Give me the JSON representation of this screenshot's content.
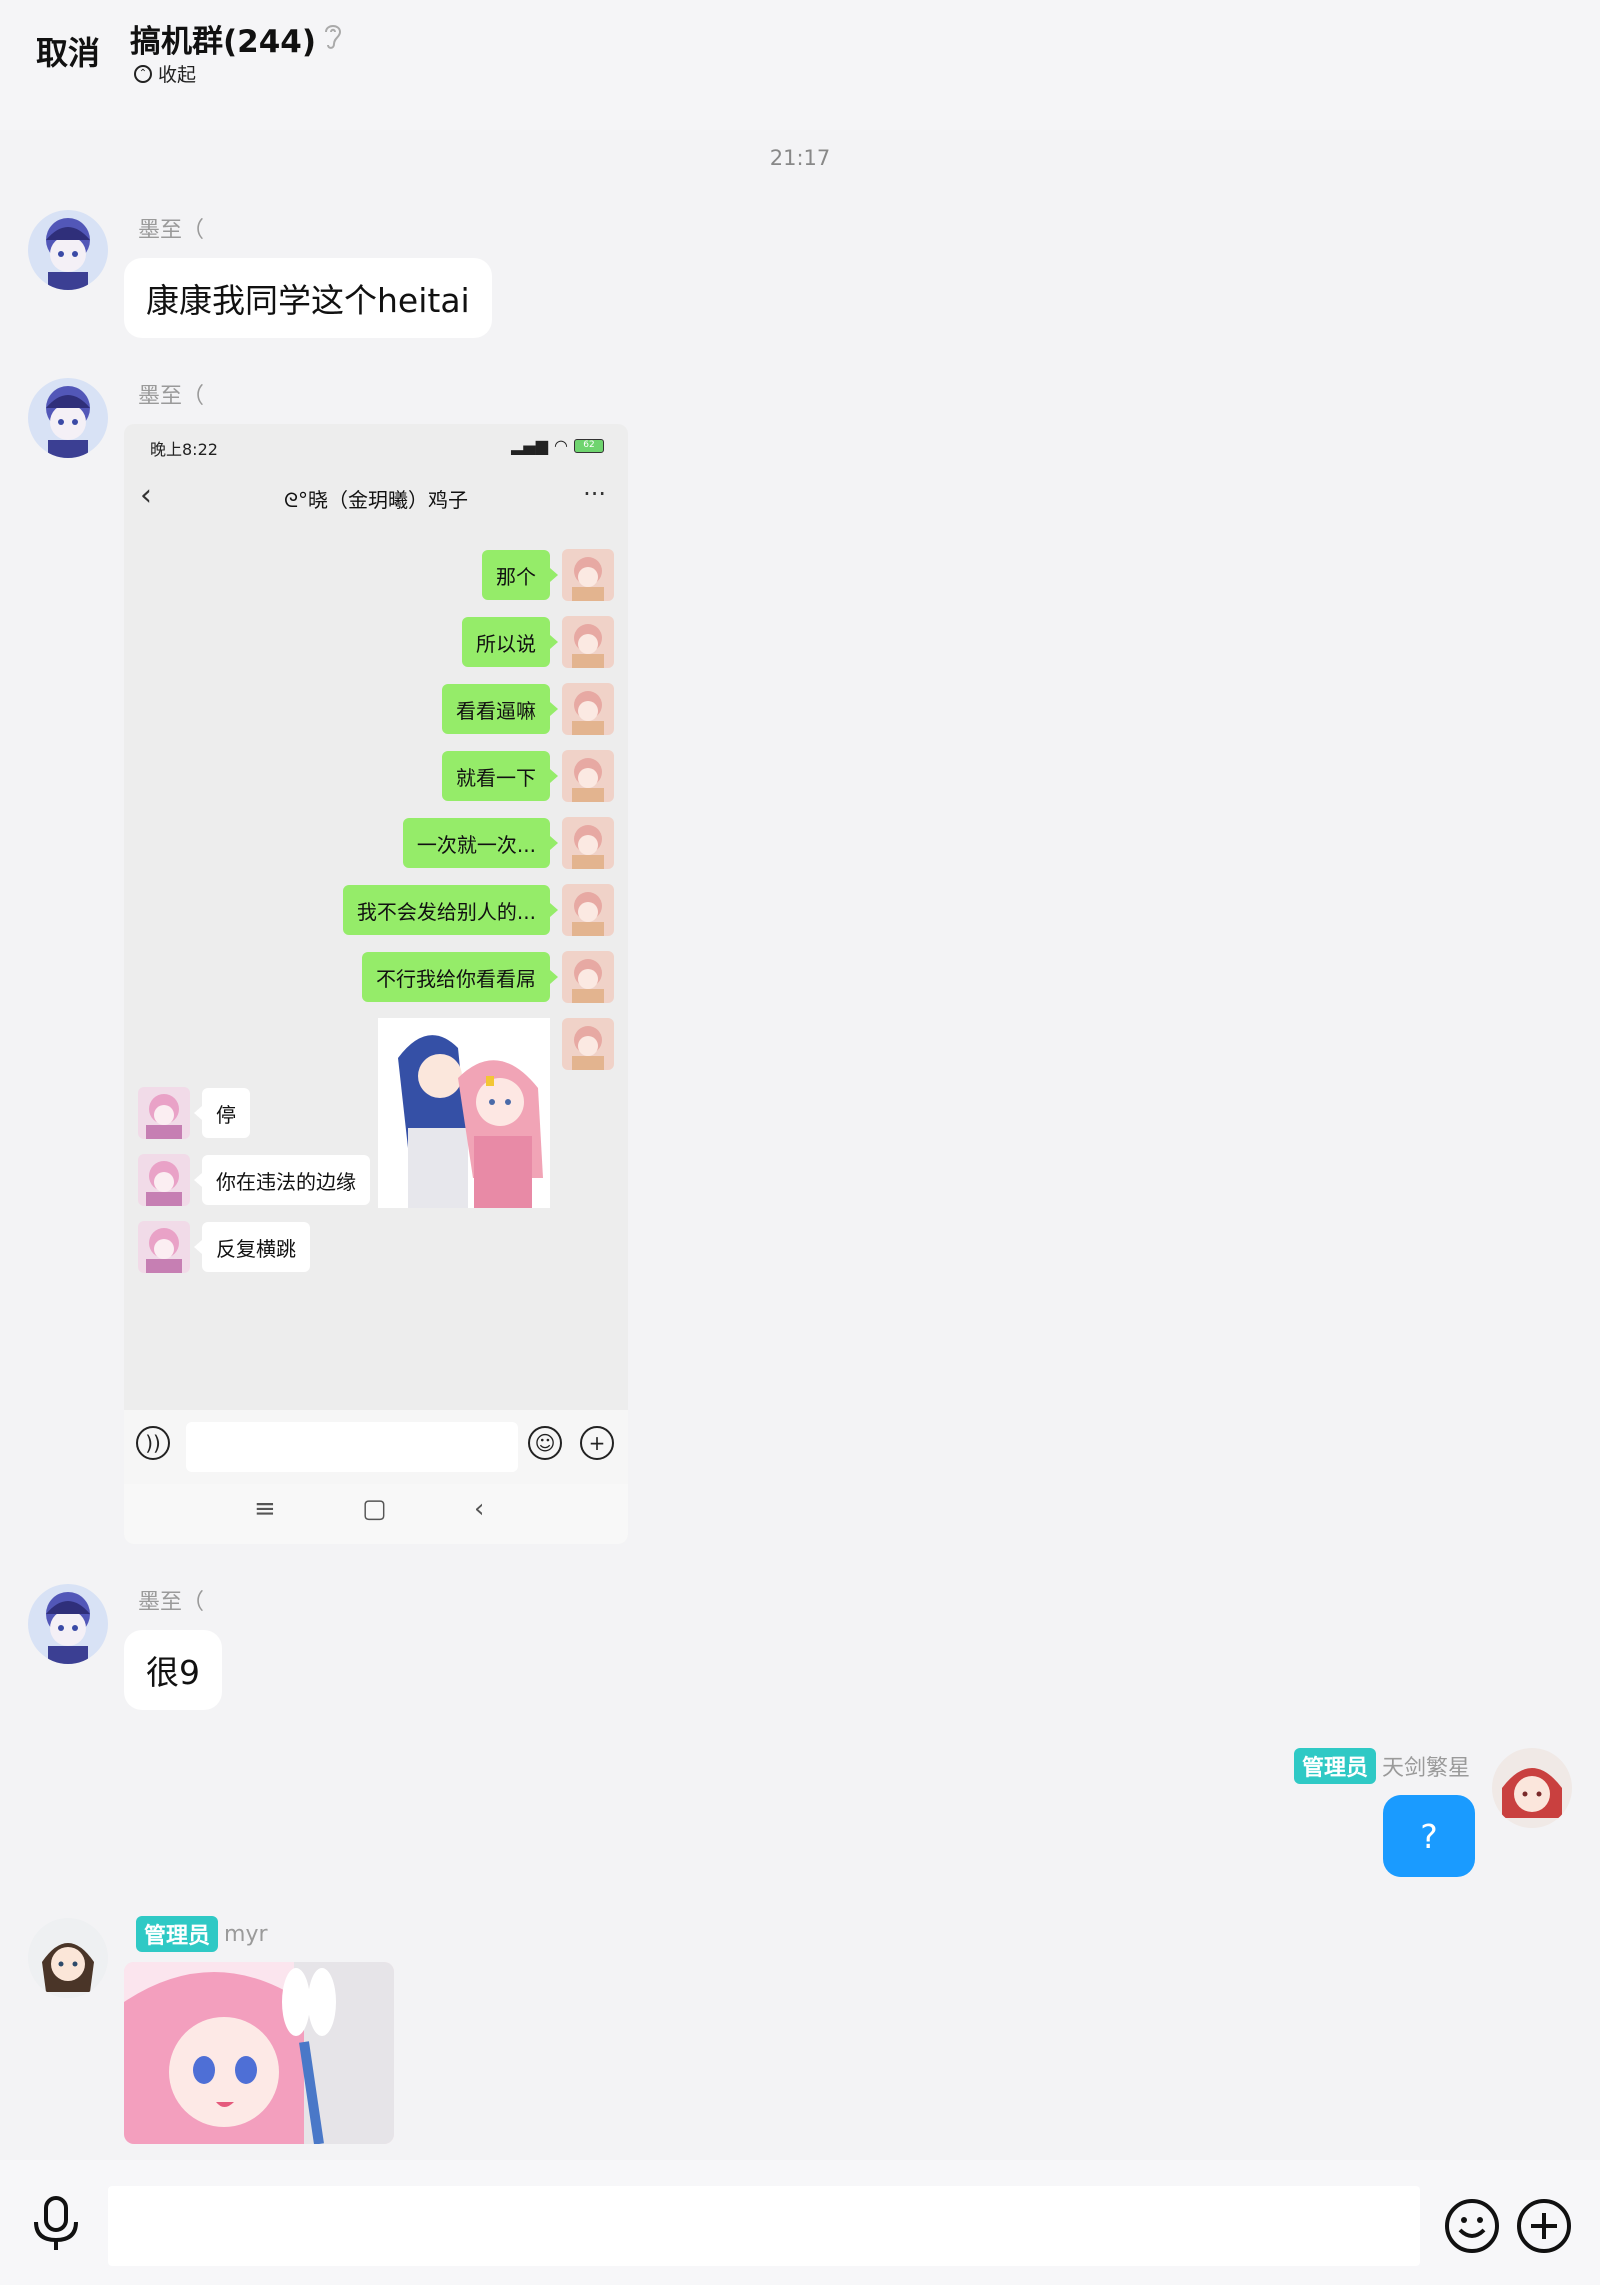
{
  "header": {
    "cancel_label": "取消",
    "title": "搞机群(244)",
    "collapse_label": "收起"
  },
  "timestamp": "21:17",
  "messages": [
    {
      "sender": "墨至（",
      "text": "康康我同学这个heitai"
    },
    {
      "sender": "墨至（"
    },
    {
      "sender": "墨至（",
      "text": "很9"
    },
    {
      "badge": "管理员",
      "sender": "天剑繁星",
      "text": "?"
    },
    {
      "badge": "管理员",
      "sender": "myr"
    }
  ],
  "screenshot": {
    "status_time": "晚上8:22",
    "battery": "62",
    "chat_title": "ᘓ°晓（金玥曦）鸡子",
    "sent": [
      "那个",
      "所以说",
      "看看逼嘛",
      "就看一下",
      "一次就一次...",
      "我不会发给别人的...",
      "不行我给你看看屌"
    ],
    "received": [
      "停",
      "你在违法的边缘",
      "反复横跳"
    ]
  },
  "colors": {
    "accent_blue": "#1a9bff",
    "admin_badge": "#2fc9c5",
    "wechat_green": "#95ec69"
  }
}
